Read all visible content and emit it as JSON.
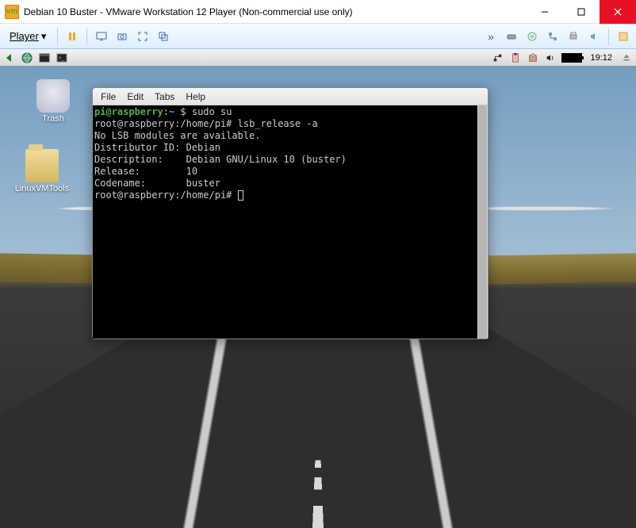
{
  "window": {
    "title": "Debian 10 Buster - VMware Workstation 12 Player (Non-commercial use only)",
    "player_menu_label": "Player"
  },
  "panel": {
    "clock": "19:12"
  },
  "desktop_icons": {
    "trash_label": "Trash",
    "folder_label": "LinuxVMTools"
  },
  "terminal": {
    "menus": [
      "File",
      "Edit",
      "Tabs",
      "Help"
    ],
    "lines": {
      "l1_userhost": "pi@raspberry",
      "l1_sep": ":",
      "l1_path": "~",
      "l1_prompt": " $ ",
      "l1_cmd": "sudo su",
      "l2": "root@raspberry:/home/pi# lsb_release -a",
      "l3": "No LSB modules are available.",
      "l4": "Distributor ID: Debian",
      "l5": "Description:    Debian GNU/Linux 10 (buster)",
      "l6": "Release:        10",
      "l7": "Codename:       buster",
      "l8": "root@raspberry:/home/pi# "
    }
  }
}
